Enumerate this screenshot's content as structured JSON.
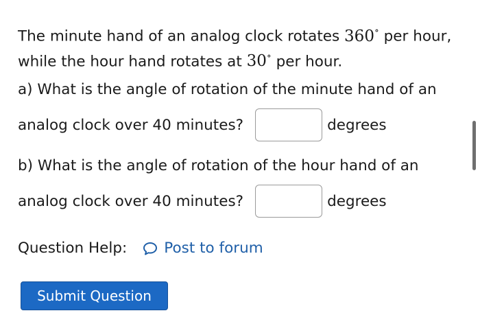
{
  "intro": {
    "text_before_360": "The minute hand of an analog clock rotates ",
    "minute_value": "360",
    "degree_symbol": "∘",
    "text_after_360": " per hour, while the hour hand rotates at ",
    "hour_value": "30",
    "text_end": " per hour."
  },
  "questions": [
    {
      "line1": "a)  What is the angle of rotation of the minute hand of an",
      "line2": "analog clock over 40 minutes?",
      "answer_value": "",
      "unit": "degrees"
    },
    {
      "line1": "b)  What is the angle of rotation of the hour hand of an",
      "line2": "analog clock over 40 minutes?",
      "answer_value": "",
      "unit": "degrees"
    }
  ],
  "help": {
    "label": "Question Help:",
    "forum_icon": "speech-bubble-icon",
    "forum_link": "Post to forum"
  },
  "submit": {
    "label": "Submit Question"
  },
  "colors": {
    "link": "#1f5fa8",
    "button_bg": "#1c69c4",
    "button_text": "#ffffff",
    "text": "#1a1a1a"
  }
}
